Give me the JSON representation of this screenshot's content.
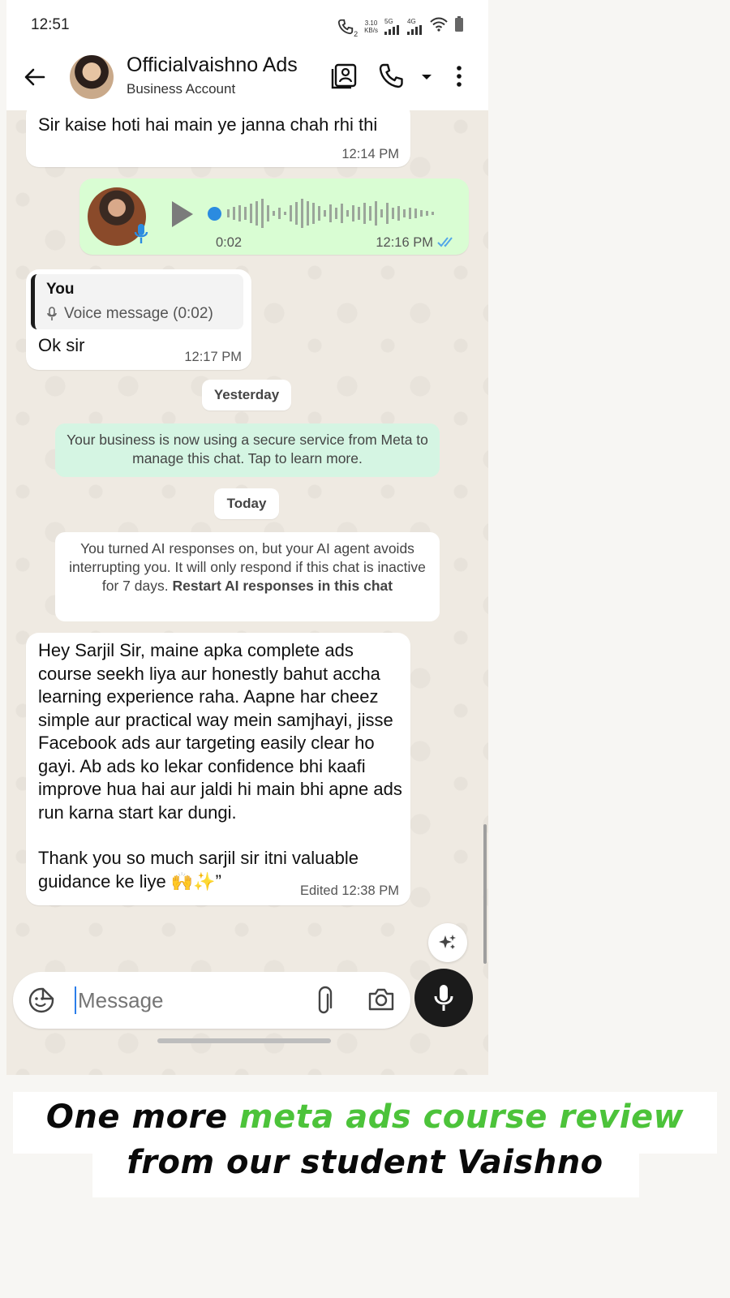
{
  "status_bar": {
    "time": "12:51",
    "net_speed_value": "3.10",
    "net_speed_unit": "KB/s",
    "net1": "5G",
    "net2": "4G",
    "sim_slot": "2"
  },
  "header": {
    "contact_name": "Officialvaishno Ads",
    "subtitle": "Business Account"
  },
  "messages": {
    "m1": {
      "text": "Sir kaise hoti hai main ye janna chah rhi thi",
      "time": "12:14 PM"
    },
    "voice": {
      "duration": "0:02",
      "time": "12:16 PM"
    },
    "reply": {
      "quoted_author": "You",
      "quoted_text": "Voice message (0:02)",
      "text": "Ok sir",
      "time": "12:17 PM"
    },
    "date_yesterday": "Yesterday",
    "system_secure": "Your business is now using a secure service from Meta to manage this chat. Tap to learn more.",
    "date_today": "Today",
    "system_ai": "You turned AI responses on, but your AI agent avoids interrupting you. It will only respond if this chat is inactive for 7 days.",
    "system_ai_link": "Restart AI responses in this chat",
    "review": {
      "text": "Hey Sarjil Sir, maine apka complete ads course seekh liya aur honestly bahut accha learning experience raha. Aapne har cheez simple aur practical way mein samjhayi, jisse Facebook ads aur targeting easily clear ho gayi. Ab ads ko lekar confidence bhi kaafi improve hua hai aur jaldi hi main bhi apne ads run karna start kar dungi.",
      "text2": "Thank you so much sarjil sir itni valuable guidance ke liye 🙌✨”",
      "time": "Edited 12:38 PM"
    }
  },
  "input": {
    "placeholder": "Message"
  },
  "caption": {
    "part1": "One more ",
    "highlight": "meta ads course review",
    "line2": "from our  student Vaishno"
  },
  "colors": {
    "accent_green": "#4cc33a",
    "chat_bg": "#efeae2",
    "outgoing_bubble": "#d9fdd3",
    "system_bubble": "#d5f5e3",
    "read_tick": "#53a6e8"
  }
}
